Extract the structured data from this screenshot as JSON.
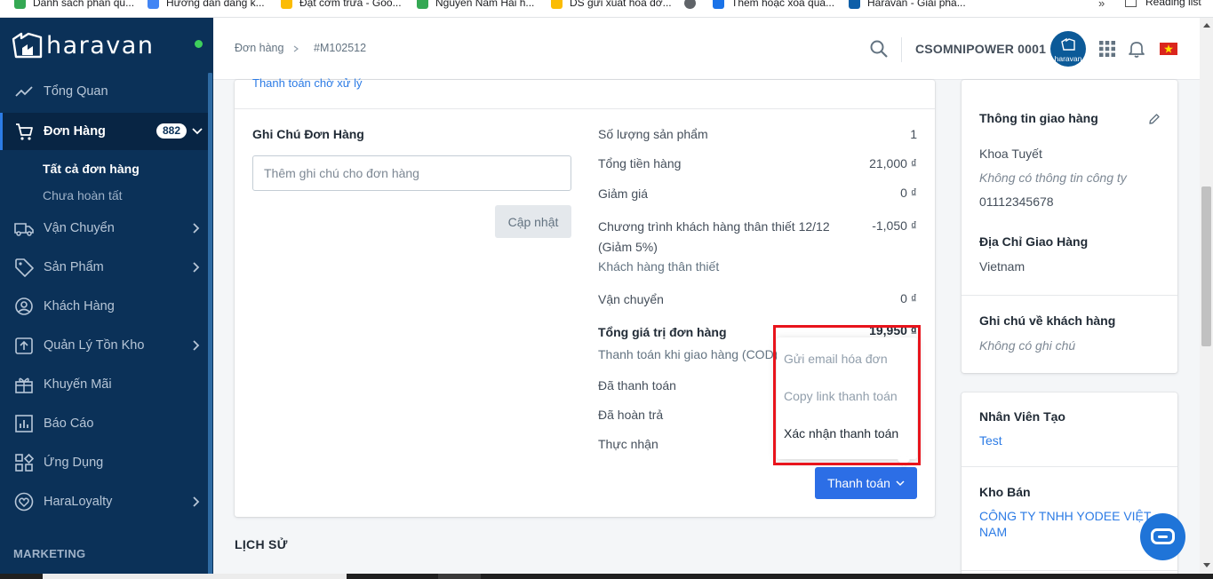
{
  "bookmarks": {
    "items": [
      {
        "label": "Danh sách phân qu...",
        "color": "#34a853"
      },
      {
        "label": "Hướng dẫn đăng k...",
        "color": "#4285f4"
      },
      {
        "label": "Đặt cơm trưa - Goo...",
        "color": "#fbbc04"
      },
      {
        "label": "Nguyễn Nam Hải h...",
        "color": "#34a853"
      },
      {
        "label": "DS gửi xuất hóa đơ...",
        "color": "#fbbc04"
      },
      {
        "label": "",
        "color": "#5f6368"
      },
      {
        "label": "Thêm hoặc xóa quả...",
        "color": "#1a73e8"
      },
      {
        "label": "Haravan - Giải phá...",
        "color": "#0d5ea8"
      }
    ],
    "more": "»",
    "reading_list": "Reading list"
  },
  "sidebar": {
    "brand": "haravan",
    "nav": [
      {
        "label": "Tổng Quan",
        "icon": "trending-icon",
        "chevron": false
      },
      {
        "label": "Đơn Hàng",
        "icon": "cart-icon",
        "badge": "882",
        "chevron": true,
        "active": true
      },
      {
        "label": "Vận Chuyển",
        "icon": "truck-icon",
        "chevron": true
      },
      {
        "label": "Sản Phẩm",
        "icon": "tag-icon",
        "chevron": true
      },
      {
        "label": "Khách Hàng",
        "icon": "user-icon",
        "chevron": false
      },
      {
        "label": "Quản Lý Tồn Kho",
        "icon": "inventory-icon",
        "chevron": true
      },
      {
        "label": "Khuyến Mãi",
        "icon": "gift-icon",
        "chevron": false
      },
      {
        "label": "Báo Cáo",
        "icon": "report-icon",
        "chevron": false
      },
      {
        "label": "Ứng Dụng",
        "icon": "apps-icon",
        "chevron": false
      },
      {
        "label": "HaraLoyalty",
        "icon": "heart-icon",
        "chevron": true
      }
    ],
    "sub_items": [
      {
        "label": "Tất cả đơn hàng",
        "active": true
      },
      {
        "label": "Chưa hoàn tất",
        "active": false
      }
    ],
    "section": "MARKETING"
  },
  "topbar": {
    "breadcrumb": [
      "Đơn hàng",
      "#M102512"
    ],
    "store_name": "CSOMNIPOWER 0001",
    "avatar_text": "haravan"
  },
  "order": {
    "pending_text": "Thanh toán chờ xử lý",
    "note_title": "Ghi Chú Đơn Hàng",
    "note_placeholder": "Thêm ghi chú cho đơn hàng",
    "update_button": "Cập nhật",
    "summary": {
      "qty_label": "Số lượng sản phẩm",
      "qty_value": "1",
      "subtotal_label": "Tổng tiền hàng",
      "subtotal_value": "21,000 ₫",
      "discount_label": "Giảm giá",
      "discount_value": "0 ₫",
      "loyalty_label_1": "Chương trình khách hàng thân thiết 12/12",
      "loyalty_label_2": "(Giảm 5%)",
      "loyalty_value": "-1,050 ₫",
      "loyalty_sub": "Khách hàng thân thiết",
      "shipping_label": "Vận chuyển",
      "shipping_value": "0 ₫",
      "total_label": "Tổng giá trị đơn hàng",
      "total_value": "19,950 ₫",
      "cod_label": "Thanh toán khi giao hàng (COD)",
      "paid_label": "Đã thanh toán",
      "refunded_label": "Đã hoàn trả",
      "received_label": "Thực nhận"
    },
    "pay_button": "Thanh toán",
    "dropdown": [
      {
        "label": "Gửi email hóa đơn",
        "enabled": false
      },
      {
        "label": "Copy link thanh toán",
        "enabled": false
      },
      {
        "label": "Xác nhận thanh toán",
        "enabled": true
      }
    ],
    "history_title": "LỊCH SỬ"
  },
  "customer": {
    "shipping_title": "Thông tin giao hàng",
    "name": "Khoa Tuyết",
    "company": "Không có thông tin công ty",
    "phone": "01112345678",
    "address_title": "Địa Chỉ Giao Hàng",
    "country": "Vietnam",
    "note_title": "Ghi chú về khách hàng",
    "note_value": "Không có ghi chú",
    "staff_title": "Nhân Viên Tạo",
    "staff_value": "Test",
    "warehouse_title": "Kho Bán",
    "warehouse_value": "CÔNG TY TNHH YODEE VIỆT NAM"
  },
  "colors": {
    "sidebar_bg": "#0b3158",
    "primary": "#2c6ee6",
    "highlight_box": "#e8141c"
  }
}
